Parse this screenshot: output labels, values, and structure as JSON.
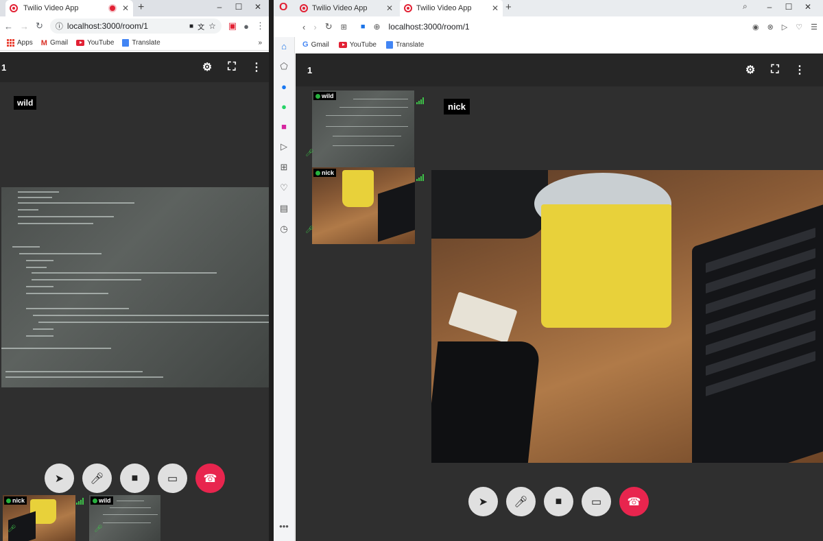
{
  "chrome": {
    "tab_title": "Twilio Video App",
    "new_tab": "+",
    "win_min": "–",
    "win_max": "☐",
    "win_close": "✕",
    "url": "localhost:3000/room/1",
    "bookmarks": [
      "Apps",
      "Gmail",
      "YouTube",
      "Translate"
    ],
    "more": "»",
    "app": {
      "room": "1",
      "main_participant": "wild",
      "thumbs": [
        {
          "name": "nick"
        },
        {
          "name": "wild"
        }
      ]
    }
  },
  "opera": {
    "tabs": [
      "Twilio Video App",
      "Twilio Video App"
    ],
    "new_tab": "+",
    "url": "localhost:3000/room/1",
    "bookmarks": [
      "Gmail",
      "YouTube",
      "Translate"
    ],
    "app": {
      "room": "1",
      "main_participant": "nick",
      "thumbs": [
        {
          "name": "wild"
        },
        {
          "name": "nick"
        }
      ]
    },
    "sidebar_more": "•••"
  },
  "icons": {
    "send": "send-icon",
    "mic": "mic-icon",
    "camera": "camera-icon",
    "share": "screen-share-icon",
    "hangup": "hang-up-icon",
    "settings": "gear-icon",
    "fullscreen": "fullscreen-icon",
    "menu": "more-vert-icon"
  },
  "colors": {
    "hangup": "#e8254e",
    "app_bg": "#2f2f2f",
    "appbar": "#262626",
    "online": "#27b13e"
  }
}
